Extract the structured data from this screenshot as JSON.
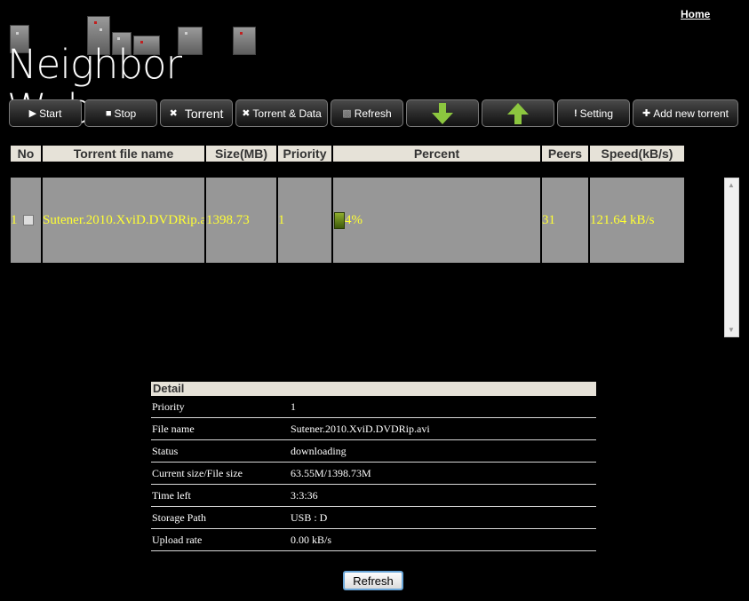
{
  "nav": {
    "home_label": "Home"
  },
  "logo": {
    "text": "Neighbor Web"
  },
  "toolbar": {
    "start_label": "Start",
    "stop_label": "Stop",
    "torrent_label": "Torrent",
    "torrent_data_label": "Torrent & Data",
    "refresh_label": "Refresh",
    "setting_label": "Setting",
    "add_label": "Add new torrent",
    "arrow_color": "#8cc63f"
  },
  "table": {
    "headers": [
      "No",
      "Torrent file name",
      "Size(MB)",
      "Priority",
      "Percent",
      "Peers",
      "Speed(kB/s)"
    ],
    "rows": [
      {
        "no": "1",
        "name": "Sutener.2010.XviD.DVDRip.a",
        "size": "1398.73",
        "priority": "1",
        "percent": "4%",
        "peers": "31",
        "speed": "121.64 kB/s"
      }
    ]
  },
  "detail": {
    "title": "Detail",
    "rows": [
      {
        "key": "Priority",
        "value": "1"
      },
      {
        "key": "File name",
        "value": "Sutener.2010.XviD.DVDRip.avi"
      },
      {
        "key": "Status",
        "value": "downloading"
      },
      {
        "key": "Current size/File size",
        "value": "63.55M/1398.73M"
      },
      {
        "key": "Time left",
        "value": "3:3:36"
      },
      {
        "key": "Storage Path",
        "value": "USB : D"
      },
      {
        "key": "Upload rate",
        "value": "0.00 kB/s"
      }
    ]
  },
  "refresh_button": {
    "label": "Refresh"
  }
}
